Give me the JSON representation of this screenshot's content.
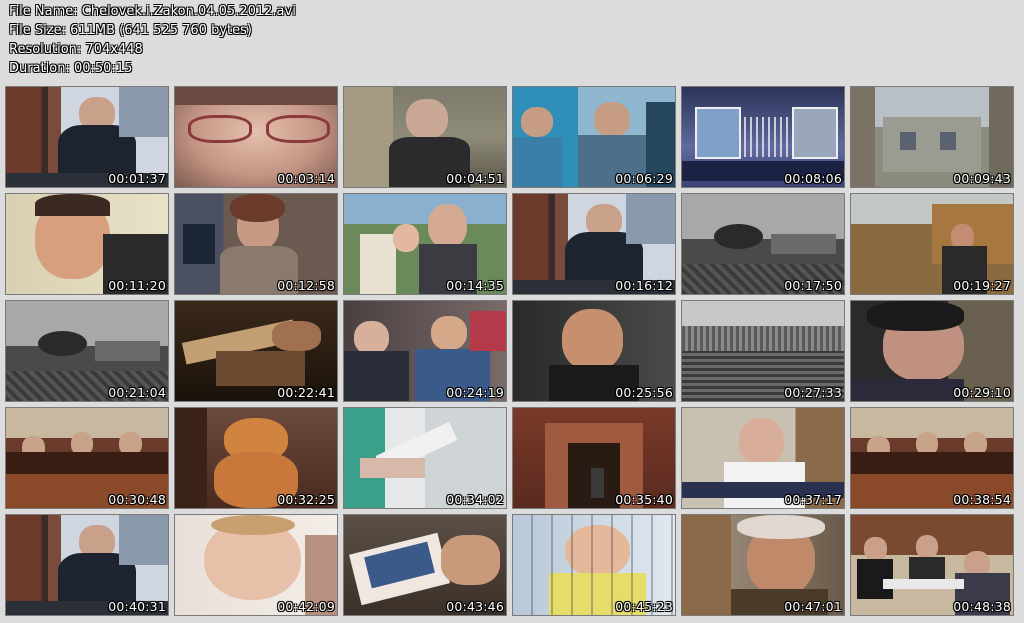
{
  "info": {
    "file_name": "File Name: Chelovek.i.Zakon.04.05.2012.avi",
    "file_size": "File Size: 611MB (641 525 760 bytes)",
    "resolution": "Resolution: 704x448",
    "duration": "Duration: 00:50:15"
  },
  "thumbnails": [
    {
      "time": "00:01:37",
      "scene": "studio-anchor"
    },
    {
      "time": "00:03:14",
      "scene": "closeup-glasses"
    },
    {
      "time": "00:04:51",
      "scene": "man-outdoors"
    },
    {
      "time": "00:06:29",
      "scene": "men-office"
    },
    {
      "time": "00:08:06",
      "scene": "screen-graphic"
    },
    {
      "time": "00:09:43",
      "scene": "building-street"
    },
    {
      "time": "00:11:20",
      "scene": "man-smiling"
    },
    {
      "time": "00:12:58",
      "scene": "woman-room"
    },
    {
      "time": "00:14:35",
      "scene": "crowd-outdoors"
    },
    {
      "time": "00:16:12",
      "scene": "studio-anchor"
    },
    {
      "time": "00:17:50",
      "scene": "archive-bw"
    },
    {
      "time": "00:19:27",
      "scene": "man-village"
    },
    {
      "time": "00:21:04",
      "scene": "archive-bw"
    },
    {
      "time": "00:22:41",
      "scene": "book-hands"
    },
    {
      "time": "00:24:19",
      "scene": "veterans"
    },
    {
      "time": "00:25:56",
      "scene": "man-portrait"
    },
    {
      "time": "00:27:33",
      "scene": "parade-bw"
    },
    {
      "time": "00:29:10",
      "scene": "man-profile"
    },
    {
      "time": "00:30:48",
      "scene": "courtroom"
    },
    {
      "time": "00:32:25",
      "scene": "cat"
    },
    {
      "time": "00:34:02",
      "scene": "hospital"
    },
    {
      "time": "00:35:40",
      "scene": "building-entrance"
    },
    {
      "time": "00:37:17",
      "scene": "doctor-office"
    },
    {
      "time": "00:38:54",
      "scene": "courtroom"
    },
    {
      "time": "00:40:31",
      "scene": "studio-anchor"
    },
    {
      "time": "00:42:09",
      "scene": "child-face"
    },
    {
      "time": "00:43:46",
      "scene": "photo-hands"
    },
    {
      "time": "00:45:23",
      "scene": "child-bed"
    },
    {
      "time": "00:47:01",
      "scene": "old-man"
    },
    {
      "time": "00:48:38",
      "scene": "people-table"
    }
  ]
}
